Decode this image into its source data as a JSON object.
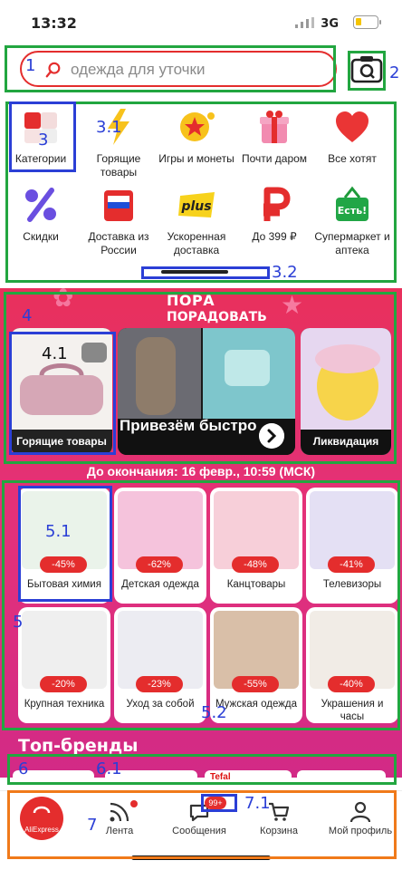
{
  "status": {
    "time": "13:32",
    "network": "3G"
  },
  "search": {
    "placeholder": "одежда для уточки"
  },
  "categories": [
    {
      "label": "Категории",
      "icon": "categories-icon"
    },
    {
      "label": "Горящие товары",
      "icon": "lightning-icon"
    },
    {
      "label": "Игры и монеты",
      "icon": "coin-star-icon"
    },
    {
      "label": "Почти даром",
      "icon": "gift-icon"
    },
    {
      "label": "Все хотят",
      "icon": "heart-icon"
    },
    {
      "label": "Скидки",
      "icon": "percent-icon"
    },
    {
      "label": "Доставка из России",
      "icon": "russia-bag-icon"
    },
    {
      "label": "Ускоренная доставка",
      "icon": "plus-icon"
    },
    {
      "label": "До 399 ₽",
      "icon": "ruble-icon"
    },
    {
      "label": "Супермаркет и аптека",
      "icon": "basket-icon"
    }
  ],
  "promo": {
    "title_top": "ПОРА",
    "title_bottom": "ПОРАДОВАТЬ",
    "cards": [
      {
        "label": "Горящие товары"
      },
      {
        "label": "Привезём быстро"
      },
      {
        "label": "Ликвидация"
      }
    ],
    "deadline": "До окончания: 16 февр., 10:59 (МСК)"
  },
  "deals": [
    {
      "label": "Бытовая химия",
      "discount": "-45%"
    },
    {
      "label": "Детская одежда",
      "discount": "-62%"
    },
    {
      "label": "Канцтовары",
      "discount": "-48%"
    },
    {
      "label": "Телевизоры",
      "discount": "-41%"
    },
    {
      "label": "Крупная техника",
      "discount": "-20%"
    },
    {
      "label": "Уход за собой",
      "discount": "-23%"
    },
    {
      "label": "Мужская одежда",
      "discount": "-55%"
    },
    {
      "label": "Украшения и часы",
      "discount": "-40%"
    }
  ],
  "brands": {
    "title": "Топ-бренды",
    "tiles": [
      "",
      "",
      "Tefal",
      ""
    ]
  },
  "tabbar": {
    "items": [
      {
        "label": "AliExpress"
      },
      {
        "label": "Лента"
      },
      {
        "label": "Сообщения",
        "badge": "99+"
      },
      {
        "label": "Корзина"
      },
      {
        "label": "Мой профиль"
      }
    ]
  },
  "annotations": [
    "1",
    "2",
    "3",
    "3.1",
    "3.2",
    "4",
    "4.1",
    "5",
    "5.1",
    "5.2",
    "6",
    "6.1",
    "7",
    "7.1"
  ],
  "colors": {
    "accent": "#e42d2d",
    "promo_bg": "#e3317b",
    "annotation_green": "#22a640",
    "annotation_blue": "#2b3fd6",
    "annotation_orange": "#f07a1a"
  }
}
